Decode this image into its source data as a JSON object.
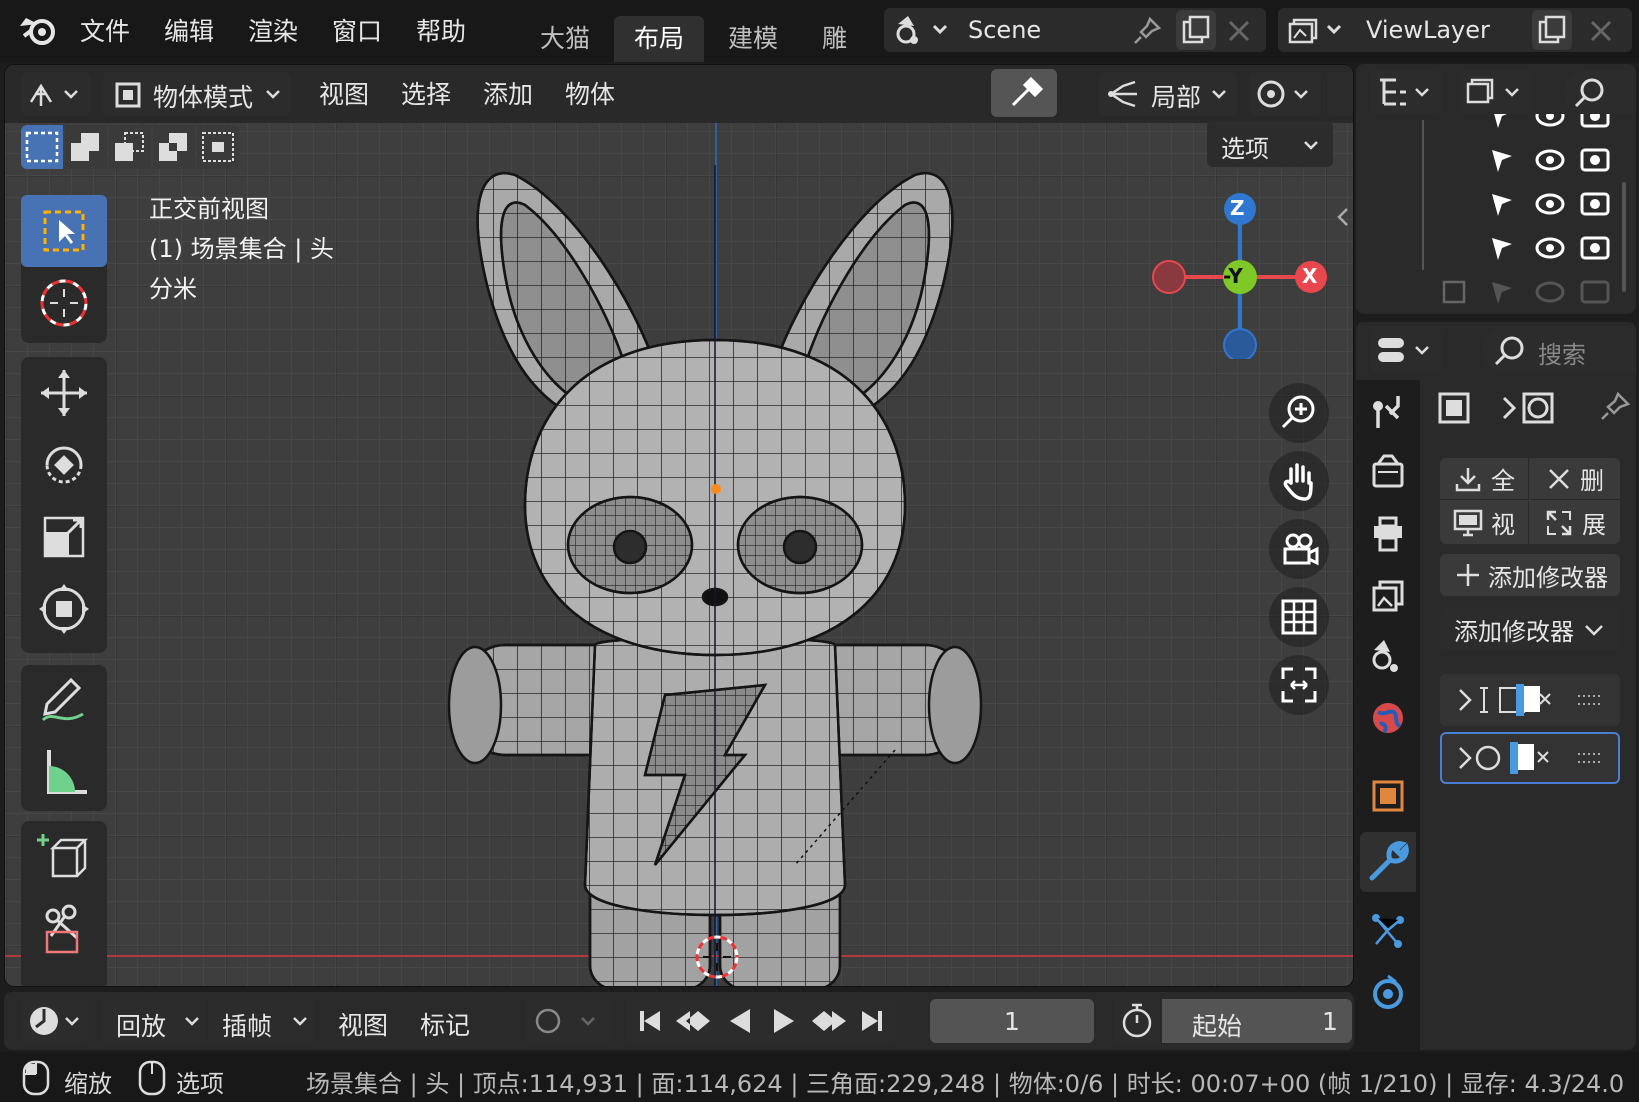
{
  "topbar": {
    "menus": [
      "文件",
      "编辑",
      "渲染",
      "窗口",
      "帮助"
    ],
    "tabs": [
      "大猫",
      "布局",
      "建模",
      "雕刻"
    ],
    "active_tab": "布局",
    "scene_name": "Scene",
    "view_layer": "ViewLayer"
  },
  "viewport": {
    "mode_label": "物体模式",
    "menus": [
      "视图",
      "选择",
      "添加",
      "物体"
    ],
    "transform_orientation": "局部",
    "options_label": "选项",
    "overlay_lines": [
      "正交前视图",
      "(1) 场景集合 | 头",
      "分米"
    ],
    "gizmo_labels": {
      "z": "Z",
      "y": "-Y",
      "x": "X"
    },
    "colors": {
      "x_axis": "#e8484d",
      "y_axis": "#7ec827",
      "z_axis": "#2f77d1",
      "accent": "#4772b3",
      "origin": "#ff8a1c"
    }
  },
  "tools": {
    "icons": [
      "select-box-icon",
      "cursor-icon",
      "move-icon",
      "rotate-icon",
      "scale-icon",
      "transform-icon",
      "annotate-icon",
      "measure-icon",
      "add-cube-icon",
      "cut-icon"
    ]
  },
  "outliner": {
    "rows": 4
  },
  "properties": {
    "search_placeholder": "搜索",
    "buttons": {
      "apply_all": "全",
      "delete_all": "删",
      "viewport": "视",
      "expand": "展"
    },
    "add_modifier_button": "添加修改器",
    "add_modifier_dropdown": "添加修改器"
  },
  "timeline": {
    "menus": [
      "回放",
      "插帧",
      "视图",
      "标记"
    ],
    "current_frame": "1",
    "start_label": "起始",
    "start_frame": "1"
  },
  "status": {
    "left_hints": [
      "缩放",
      "选项"
    ],
    "info": "场景集合 | 头 | 顶点:114,931 | 面:114,624 | 三角面:229,248 | 物体:0/6 | 时长: 00:07+00 (帧 1/210) | 显存: 4.3/24.0"
  }
}
